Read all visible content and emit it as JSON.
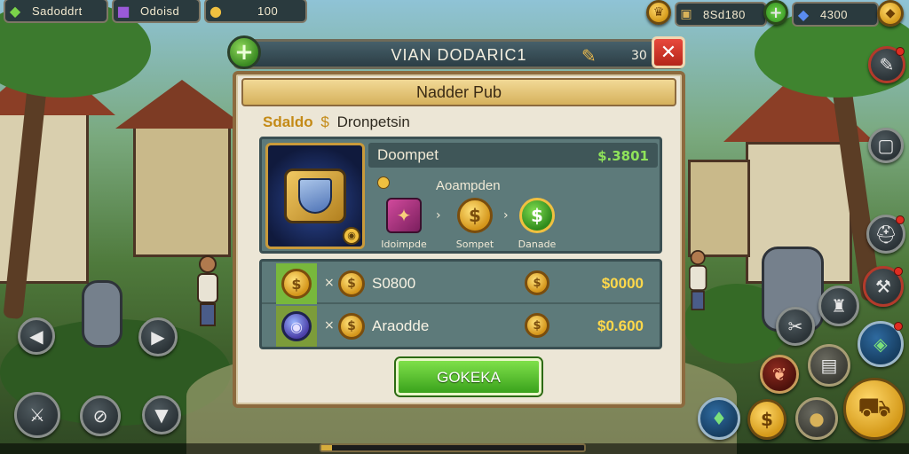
{
  "top_bar": {
    "resource_1": {
      "icon": "green-gem-icon",
      "value": "Sadoddrt"
    },
    "resource_2": {
      "icon": "purple-gem-icon",
      "value": "Odoisd"
    },
    "resource_3": {
      "icon": "gold-coin-icon",
      "value": "100"
    },
    "resource_4": {
      "icon": "crown-avatar-icon",
      "value": "8Sd180"
    },
    "resource_5": {
      "icon": "blue-gem-icon",
      "value": "4300"
    }
  },
  "dialog": {
    "header_title": "VIAN DODARIC1",
    "header_count": "30",
    "banner_title": "Nadder Pub",
    "subheading_gold": "Sdaldo",
    "subheading_coin": "$",
    "subheading_rest": "Dronpetsin",
    "offer": {
      "name": "Doompet",
      "price": "$.3801",
      "recipe_label": "Aoampden",
      "steps": [
        {
          "icon": "magic-book-icon",
          "symbol": "✦",
          "label": "Idoimpde"
        },
        {
          "icon": "gold-coin-icon",
          "symbol": "$",
          "label": "Sompet"
        },
        {
          "icon": "green-coin-icon",
          "symbol": "$",
          "label": "Danade"
        }
      ]
    },
    "rows": [
      {
        "icon": "gold-coin-icon",
        "symbol": "$",
        "times": "×",
        "coin": "$",
        "label": "S0800",
        "coin2": "$",
        "amount": "$0000"
      },
      {
        "icon": "purple-orb-icon",
        "symbol": "◉",
        "times": "×",
        "coin": "$",
        "label": "Araodde",
        "coin2": "$",
        "amount": "$0.600"
      }
    ],
    "confirm_label": "GOKEKA",
    "close_symbol": "✕",
    "plus_symbol": "+"
  },
  "progress": {
    "fraction": 0.04
  },
  "colors": {
    "dialog_parchment": "#ece6d6",
    "panel_teal": "#5d7a7a",
    "confirm_green": "#3aa21c",
    "price_gold": "#ffd84a",
    "price_green": "#8fe35a",
    "close_red": "#e8493c"
  }
}
